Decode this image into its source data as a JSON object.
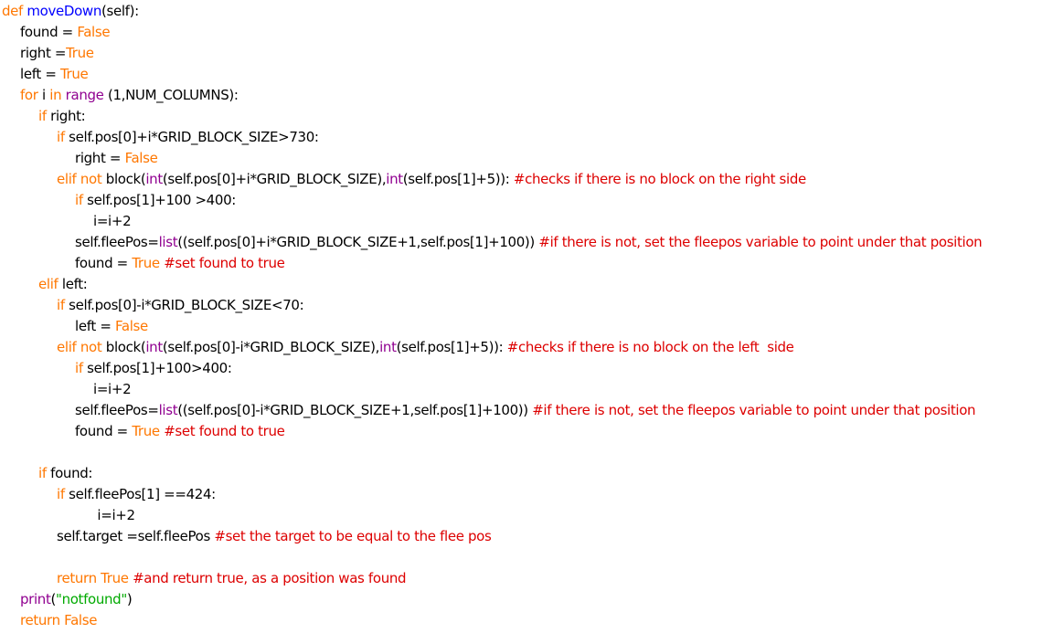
{
  "colors": {
    "background": "#ffffff",
    "keyword": "#ff7700",
    "definition": "#0000ff",
    "builtin": "#900090",
    "comment": "#dd0000",
    "string": "#00aa00",
    "text": "#000000"
  },
  "editor": {
    "lines": [
      {
        "indent": 0,
        "tokens": [
          {
            "t": "kw",
            "v": "def "
          },
          {
            "t": "def",
            "v": "moveDown"
          },
          {
            "t": "plain",
            "v": "(self):"
          }
        ]
      },
      {
        "indent": 1,
        "tokens": [
          {
            "t": "plain",
            "v": "found = "
          },
          {
            "t": "kw",
            "v": "False"
          }
        ]
      },
      {
        "indent": 1,
        "tokens": [
          {
            "t": "plain",
            "v": "right ="
          },
          {
            "t": "kw",
            "v": "True"
          }
        ]
      },
      {
        "indent": 1,
        "tokens": [
          {
            "t": "plain",
            "v": "left = "
          },
          {
            "t": "kw",
            "v": "True"
          }
        ]
      },
      {
        "indent": 1,
        "tokens": [
          {
            "t": "kw",
            "v": "for "
          },
          {
            "t": "plain",
            "v": "i "
          },
          {
            "t": "kw",
            "v": "in "
          },
          {
            "t": "builtin",
            "v": "range"
          },
          {
            "t": "plain",
            "v": " (1,NUM_COLUMNS):"
          }
        ]
      },
      {
        "indent": 2,
        "tokens": [
          {
            "t": "kw",
            "v": "if "
          },
          {
            "t": "plain",
            "v": "right:"
          }
        ]
      },
      {
        "indent": 3,
        "tokens": [
          {
            "t": "kw",
            "v": "if "
          },
          {
            "t": "plain",
            "v": "self.pos[0]+i*GRID_BLOCK_SIZE>730:"
          }
        ]
      },
      {
        "indent": 4,
        "tokens": [
          {
            "t": "plain",
            "v": "right = "
          },
          {
            "t": "kw",
            "v": "False"
          }
        ]
      },
      {
        "indent": 3,
        "tokens": [
          {
            "t": "kw",
            "v": "elif not "
          },
          {
            "t": "plain",
            "v": "block("
          },
          {
            "t": "builtin",
            "v": "int"
          },
          {
            "t": "plain",
            "v": "(self.pos[0]+i*GRID_BLOCK_SIZE),"
          },
          {
            "t": "builtin",
            "v": "int"
          },
          {
            "t": "plain",
            "v": "(self.pos[1]+5)): "
          },
          {
            "t": "comment",
            "v": "#checks if there is no block on the right side"
          }
        ]
      },
      {
        "indent": 4,
        "tokens": [
          {
            "t": "kw",
            "v": "if "
          },
          {
            "t": "plain",
            "v": "self.pos[1]+100 >400:"
          }
        ]
      },
      {
        "indent": 5,
        "tokens": [
          {
            "t": "plain",
            "v": "i=i+2"
          }
        ]
      },
      {
        "indent": 4,
        "tokens": [
          {
            "t": "plain",
            "v": "self.fleePos="
          },
          {
            "t": "builtin",
            "v": "list"
          },
          {
            "t": "plain",
            "v": "((self.pos[0]+i*GRID_BLOCK_SIZE+1,self.pos[1]+100)) "
          },
          {
            "t": "comment",
            "v": "#if there is not, set the fleepos variable to point under that position"
          }
        ]
      },
      {
        "indent": 4,
        "tokens": [
          {
            "t": "plain",
            "v": "found = "
          },
          {
            "t": "kw",
            "v": "True "
          },
          {
            "t": "comment",
            "v": "#set found to true"
          }
        ]
      },
      {
        "indent": 2,
        "tokens": [
          {
            "t": "kw",
            "v": "elif "
          },
          {
            "t": "plain",
            "v": "left:"
          }
        ]
      },
      {
        "indent": 3,
        "tokens": [
          {
            "t": "kw",
            "v": "if "
          },
          {
            "t": "plain",
            "v": "self.pos[0]-i*GRID_BLOCK_SIZE<70:"
          }
        ]
      },
      {
        "indent": 4,
        "tokens": [
          {
            "t": "plain",
            "v": "left = "
          },
          {
            "t": "kw",
            "v": "False"
          }
        ]
      },
      {
        "indent": 3,
        "tokens": [
          {
            "t": "kw",
            "v": "elif not "
          },
          {
            "t": "plain",
            "v": "block("
          },
          {
            "t": "builtin",
            "v": "int"
          },
          {
            "t": "plain",
            "v": "(self.pos[0]-i*GRID_BLOCK_SIZE),"
          },
          {
            "t": "builtin",
            "v": "int"
          },
          {
            "t": "plain",
            "v": "(self.pos[1]+5)): "
          },
          {
            "t": "comment",
            "v": "#checks if there is no block on the left  side"
          }
        ]
      },
      {
        "indent": 4,
        "tokens": [
          {
            "t": "kw",
            "v": "if "
          },
          {
            "t": "plain",
            "v": "self.pos[1]+100>400:"
          }
        ]
      },
      {
        "indent": 5,
        "tokens": [
          {
            "t": "plain",
            "v": "i=i+2"
          }
        ]
      },
      {
        "indent": 4,
        "tokens": [
          {
            "t": "plain",
            "v": "self.fleePos="
          },
          {
            "t": "builtin",
            "v": "list"
          },
          {
            "t": "plain",
            "v": "((self.pos[0]-i*GRID_BLOCK_SIZE+1,self.pos[1]+100)) "
          },
          {
            "t": "comment",
            "v": "#if there is not, set the fleepos variable to point under that position"
          }
        ]
      },
      {
        "indent": 4,
        "tokens": [
          {
            "t": "plain",
            "v": "found = "
          },
          {
            "t": "kw",
            "v": "True "
          },
          {
            "t": "comment",
            "v": "#set found to true"
          }
        ]
      },
      {
        "indent": 0,
        "tokens": []
      },
      {
        "indent": 2,
        "tokens": [
          {
            "t": "kw",
            "v": "if "
          },
          {
            "t": "plain",
            "v": "found:"
          }
        ]
      },
      {
        "indent": 3,
        "tokens": [
          {
            "t": "kw",
            "v": "if "
          },
          {
            "t": "plain",
            "v": "self.fleePos[1] ==424:"
          }
        ]
      },
      {
        "indent": 5,
        "tokens": [
          {
            "t": "plain",
            "v": " i=i+2"
          }
        ]
      },
      {
        "indent": 3,
        "tokens": [
          {
            "t": "plain",
            "v": "self.target =self.fleePos "
          },
          {
            "t": "comment",
            "v": "#set the target to be equal to the flee pos"
          }
        ]
      },
      {
        "indent": 0,
        "tokens": []
      },
      {
        "indent": 3,
        "tokens": [
          {
            "t": "kw",
            "v": "return True "
          },
          {
            "t": "comment",
            "v": "#and return true, as a position was found"
          }
        ]
      },
      {
        "indent": 1,
        "tokens": [
          {
            "t": "builtin",
            "v": "print"
          },
          {
            "t": "plain",
            "v": "("
          },
          {
            "t": "string",
            "v": "\"notfound\""
          },
          {
            "t": "plain",
            "v": ")"
          }
        ]
      },
      {
        "indent": 1,
        "tokens": [
          {
            "t": "kw",
            "v": "return False"
          }
        ]
      }
    ]
  }
}
